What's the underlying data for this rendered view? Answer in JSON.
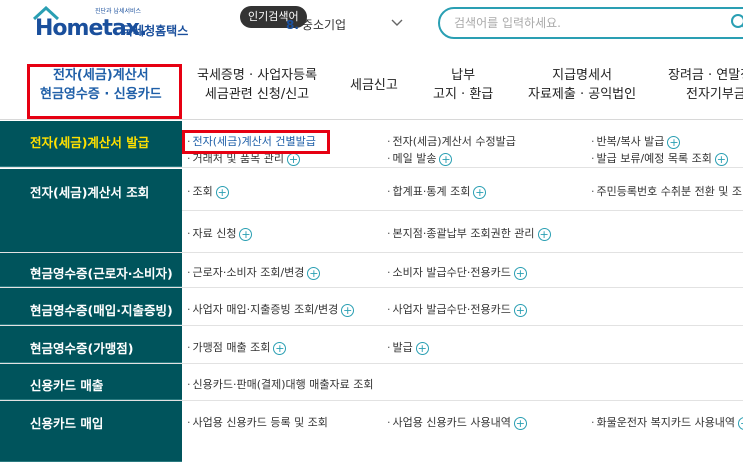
{
  "header": {
    "logo_small": "진단과 납세서비스",
    "logo_main_prefix": "Home",
    "logo_main_suffix": "tax.",
    "logo_sub": "국세청홈택스",
    "popular_badge": "인기검색어",
    "popular_rank": "8.",
    "popular_term": "중소기업",
    "search_placeholder": "검색어를 입력하세요."
  },
  "nav": {
    "items": [
      {
        "l1": "전자(세금)계산서",
        "l2": "현금영수증 · 신용카드"
      },
      {
        "l1": "국세증명 · 사업자등록",
        "l2": "세금관련 신청/신고"
      },
      {
        "l1": "세금신고",
        "l2": ""
      },
      {
        "l1": "납부",
        "l2": "고지 · 환급"
      },
      {
        "l1": "지급명세서",
        "l2": "자료제출 · 공익법인"
      },
      {
        "l1": "장려금 · 연말정",
        "l2": "전자기부금"
      }
    ]
  },
  "menu": {
    "rows": [
      {
        "label": "전자(세금)계산서 발급",
        "links": [
          {
            "text": "전자(세금)계산서 건별발급",
            "plus": false
          },
          {
            "text": "전자(세금)계산서 수정발급",
            "plus": false
          },
          {
            "text": "반복/복사 발급",
            "plus": true
          },
          {
            "text": "거래처 및 품목 관리",
            "plus": true
          },
          {
            "text": "메일 발송",
            "plus": true
          },
          {
            "text": "발급 보류/예정 목록 조회",
            "plus": true
          }
        ]
      },
      {
        "label": "전자(세금)계산서 조회",
        "links": [
          {
            "text": "조회",
            "plus": true
          },
          {
            "text": "합계표·통계 조회",
            "plus": true
          },
          {
            "text": "주민등록번호 수취분 전환 및 조",
            "plus": false
          },
          {
            "text": "자료 신청",
            "plus": true
          },
          {
            "text": "본지점·종괄납부 조회권한 관리",
            "plus": true
          }
        ]
      },
      {
        "label": "현금영수증(근로자·소비자)",
        "links": [
          {
            "text": "근로자·소비자 조회/변경",
            "plus": true
          },
          {
            "text": "소비자 발급수단·전용카드",
            "plus": true
          }
        ]
      },
      {
        "label": "현금영수증(매입·지출증빙)",
        "links": [
          {
            "text": "사업자 매입·지출증빙 조회/변경",
            "plus": true
          },
          {
            "text": "사업자 발급수단·전용카드",
            "plus": true
          }
        ]
      },
      {
        "label": "현금영수증(가맹점)",
        "links": [
          {
            "text": "가맹점 매출 조회",
            "plus": true
          },
          {
            "text": "발급",
            "plus": true
          }
        ]
      },
      {
        "label": "신용카드 매출",
        "links": [
          {
            "text": "신용카드·판매(결제)대행 매출자료 조회",
            "plus": false
          }
        ]
      },
      {
        "label": "신용카드 매입",
        "links": [
          {
            "text": "사업용 신용카드 등록 및 조회",
            "plus": false
          },
          {
            "text": "사업용 신용카드 사용내역",
            "plus": true
          },
          {
            "text": "화물운전자 복지카드 사용내역",
            "plus": true
          }
        ]
      }
    ]
  },
  "colors": {
    "sidebar": "#00545c",
    "highlight": "#e60012",
    "accent": "#1f5fa8",
    "active_label": "#ffe000"
  }
}
